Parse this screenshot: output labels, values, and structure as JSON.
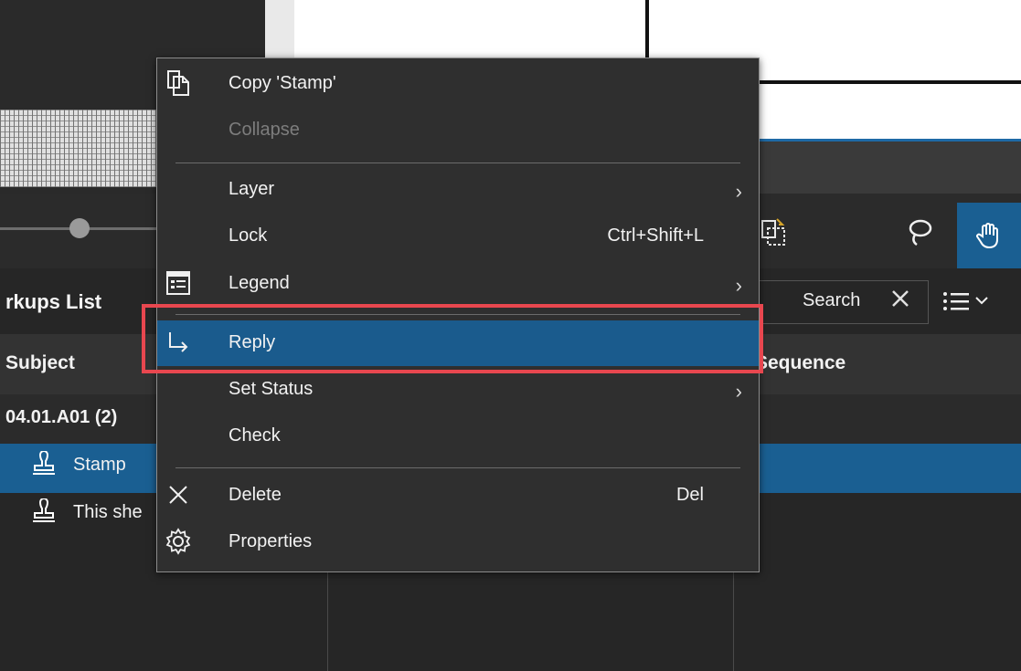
{
  "panel": {
    "title": "rkups List",
    "search_label": "Search",
    "columns": {
      "subject": "Subject",
      "sequence": "Sequence"
    },
    "group": "04.01.A01 (2)",
    "rows": [
      {
        "label": "Stamp",
        "selected": true
      },
      {
        "label": "This she",
        "selected": false
      }
    ]
  },
  "context_menu": {
    "items": [
      {
        "label": "Copy 'Stamp'",
        "icon": "copy-icon",
        "enabled": true
      },
      {
        "label": "Collapse",
        "enabled": false
      },
      {
        "label": "Layer",
        "submenu": true
      },
      {
        "label": "Lock",
        "shortcut": "Ctrl+Shift+L"
      },
      {
        "label": "Legend",
        "icon": "legend-icon",
        "submenu": true
      },
      {
        "label": "Reply",
        "icon": "reply-arrow-icon",
        "highlighted": true
      },
      {
        "label": "Set Status",
        "submenu": true
      },
      {
        "label": "Check"
      },
      {
        "label": "Delete",
        "icon": "close-icon",
        "shortcut": "Del"
      },
      {
        "label": "Properties",
        "icon": "gear-icon"
      }
    ]
  },
  "colors": {
    "accent": "#1a5f92",
    "highlight_border": "#e8474f",
    "menu_bg": "#2f2f2f"
  }
}
